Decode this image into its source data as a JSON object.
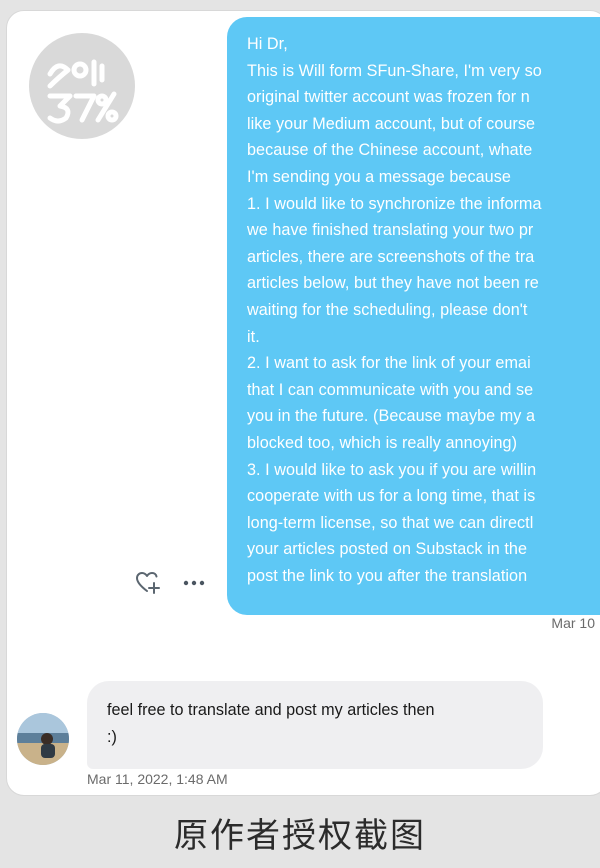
{
  "conversation": {
    "sent_message": {
      "lines": [
        "Hi Dr,",
        "This is Will form SFun-Share, I'm very so",
        "original twitter account was frozen for n",
        "like your Medium account, but of course",
        "because of the Chinese account, whate",
        "I'm sending you a message because",
        "1. I would like to synchronize the informa",
        "we have finished translating your two pr",
        "articles, there are screenshots of the tra",
        "articles below, but they have not been re",
        "waiting for the scheduling, please don't",
        "it.",
        "2. I want to ask for the link of your emai",
        "that I can communicate with you and se",
        "you in the future. (Because maybe my a",
        "blocked too, which is really annoying)",
        "3. I would like to ask you if you are willin",
        "cooperate with us for a long time, that is",
        "long-term license, so that we can directl",
        "your articles posted on Substack in the",
        "post the link to you after the translation"
      ],
      "timestamp": "Mar 10"
    },
    "received_message": {
      "lines": [
        "feel free to translate and post my articles then",
        ":)"
      ],
      "timestamp": "Mar 11, 2022, 1:48 AM"
    },
    "icons": {
      "react": "heart-plus-icon",
      "more": "more-horizontal-icon",
      "logo": "sfun-logo-icon"
    },
    "colors": {
      "sent_bubble": "#5ec8f5",
      "received_bubble": "#efeff1",
      "logo_circle": "#d9d9d9"
    }
  },
  "caption": {
    "text": "原作者授权截图"
  }
}
